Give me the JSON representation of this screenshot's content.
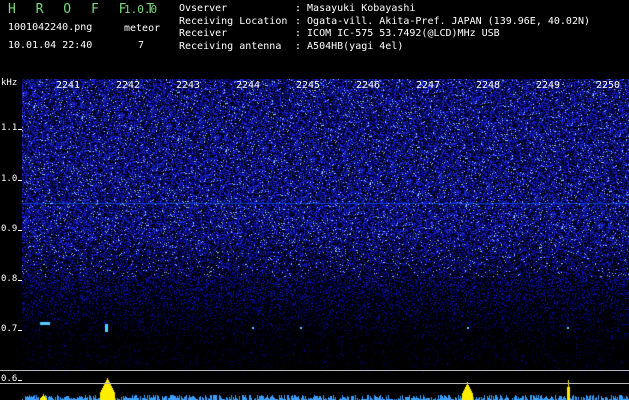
{
  "header": {
    "app_name": "H R O F F T",
    "app_version": "1.0.0",
    "file_name": "1001042240.png",
    "meteor_label": "meteor",
    "datetime": "10.01.04 22:40",
    "meteor_count": "7"
  },
  "info": [
    {
      "key": "Ovserver",
      "value": ": Masayuki Kobayashi"
    },
    {
      "key": "Receiving Location",
      "value": ": Ogata-vill. Akita-Pref. JAPAN (139.96E, 40.02N)"
    },
    {
      "key": "Receiver",
      "value": ": ICOM IC-575 53.7492(@LCD)MHz USB"
    },
    {
      "key": "Receiving antenna",
      "value": ": A504HB(yagi 4el)"
    }
  ],
  "axis": {
    "y_unit": "kHz",
    "y_ticks": [
      "1.1",
      "1.0",
      "0.9",
      "0.8",
      "0.7",
      "0.6"
    ],
    "x_ticks": [
      "2241",
      "2242",
      "2243",
      "2244",
      "2245",
      "2246",
      "2247",
      "2248",
      "2249",
      "2250"
    ]
  },
  "colors": {
    "background": "#000000",
    "spectrum_blue": "#1a2cff",
    "title_green": "#7fd67f",
    "echo_cyan": "#5ad0ff",
    "meter_yellow": "#ffee00"
  }
}
